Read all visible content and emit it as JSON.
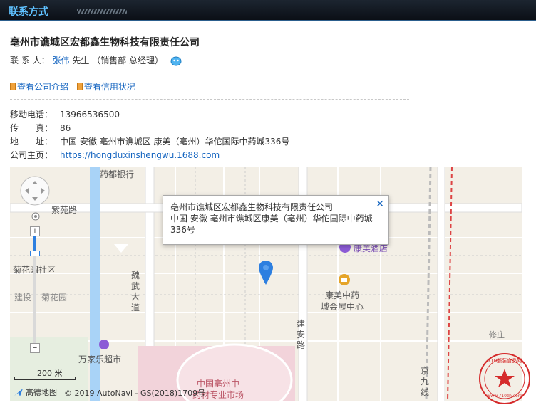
{
  "header": {
    "title": "联系方式"
  },
  "company": {
    "name": "亳州市谯城区宏都鑫生物科技有限责任公司"
  },
  "contact": {
    "label": "联 系 人：",
    "name": "张伟",
    "title": "先生 （销售部 总经理）"
  },
  "links": {
    "intro": "查看公司介绍",
    "credit": "查看信用状况"
  },
  "info": {
    "mobile_label": "移动电话：",
    "mobile": "13966536500",
    "fax_label": "传　　真：",
    "fax": "86",
    "address_label": "地　　址：",
    "address": "中国 安徽 亳州市谯城区 康美（亳州）华佗国际中药城336号",
    "homepage_label": "公司主页：",
    "homepage": "https://hongduxinshengwu.1688.com"
  },
  "map": {
    "popup_line1": "亳州市谯城区宏都鑫生物科技有限责任公司",
    "popup_line2": "中国 安徽 亳州市谯城区康美（亳州）华佗国际中药城",
    "popup_line3": "336号",
    "scale": "200 米",
    "copyright": "© 2019 AutoNavi - GS(2018)1709号",
    "brand": "高德地图",
    "streets": {
      "yaodu_bank": "药都银行",
      "ziyuan_road": "紫苑路",
      "juhua_park_community": "菊花园社区",
      "jianshe": "建投",
      "juhua_park": "菊花园",
      "weiwu": "魏武大道",
      "kangmei_hotel": "康美酒店",
      "kangmei_center_1": "康美中药",
      "kangmei_center_2": "城会展中心",
      "jianan_road": "建安路",
      "wanjiale": "万家乐超市",
      "market_1": "中国亳州中",
      "market_2": "药材专业市场",
      "jingjiu": "京九线",
      "xiuzhuang": "修庄"
    }
  },
  "stamp": {
    "text": "710服装食品网",
    "url": "www.710zh.com"
  }
}
